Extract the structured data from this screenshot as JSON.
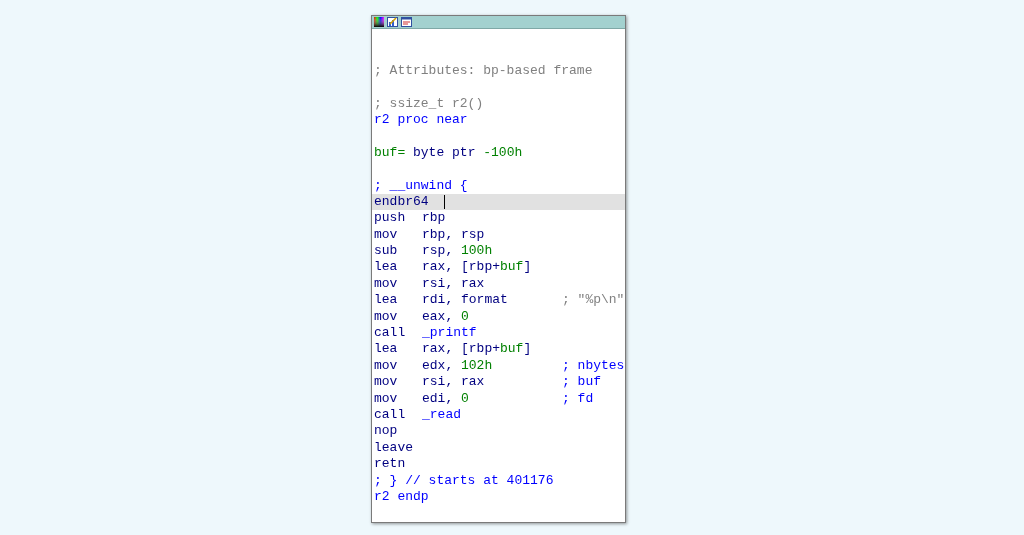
{
  "lines": [
    {
      "kind": "blank"
    },
    {
      "kind": "blank"
    },
    {
      "kind": "text",
      "selected": false,
      "parts": [
        {
          "text": "; Attributes: bp-based frame",
          "kind": "comment"
        }
      ]
    },
    {
      "kind": "blank"
    },
    {
      "kind": "text",
      "selected": false,
      "parts": [
        {
          "text": "; ssize_t r2()",
          "kind": "comment"
        }
      ]
    },
    {
      "kind": "text",
      "selected": false,
      "parts": [
        {
          "text": "r2 proc near",
          "kind": "name"
        }
      ]
    },
    {
      "kind": "blank"
    },
    {
      "kind": "text",
      "selected": false,
      "parts": [
        {
          "text": "buf=",
          "kind": "num"
        },
        {
          "text": " byte ptr ",
          "kind": "plain"
        },
        {
          "text": "-100h",
          "kind": "num"
        }
      ]
    },
    {
      "kind": "blank"
    },
    {
      "kind": "text",
      "selected": false,
      "parts": [
        {
          "text": "; __unwind {",
          "kind": "name"
        }
      ]
    },
    {
      "kind": "code",
      "selected": true,
      "mnemonic": "endbr64"
    },
    {
      "kind": "code",
      "selected": false,
      "mnemonic": "push",
      "operands": [
        {
          "text": "rbp",
          "kind": "plain"
        }
      ]
    },
    {
      "kind": "code",
      "selected": false,
      "mnemonic": "mov",
      "operands": [
        {
          "text": "rbp, rsp",
          "kind": "plain"
        }
      ]
    },
    {
      "kind": "code",
      "selected": false,
      "mnemonic": "sub",
      "operands": [
        {
          "text": "rsp, ",
          "kind": "plain"
        },
        {
          "text": "100h",
          "kind": "num"
        }
      ]
    },
    {
      "kind": "code",
      "selected": false,
      "mnemonic": "lea",
      "operands": [
        {
          "text": "rax, [rbp+",
          "kind": "plain"
        },
        {
          "text": "buf",
          "kind": "num"
        },
        {
          "text": "]",
          "kind": "plain"
        }
      ]
    },
    {
      "kind": "code",
      "selected": false,
      "mnemonic": "mov",
      "operands": [
        {
          "text": "rsi, rax",
          "kind": "plain"
        }
      ]
    },
    {
      "kind": "code",
      "selected": false,
      "mnemonic": "lea",
      "operands": [
        {
          "text": "rdi, format",
          "kind": "plain"
        }
      ],
      "comment": {
        "text": "; \"%p\\n\"",
        "kind": "comment"
      }
    },
    {
      "kind": "code",
      "selected": false,
      "mnemonic": "mov",
      "operands": [
        {
          "text": "eax, ",
          "kind": "plain"
        },
        {
          "text": "0",
          "kind": "num"
        }
      ]
    },
    {
      "kind": "code",
      "selected": false,
      "mnemonic": "call",
      "operands": [
        {
          "text": "_printf",
          "kind": "name"
        }
      ]
    },
    {
      "kind": "code",
      "selected": false,
      "mnemonic": "lea",
      "operands": [
        {
          "text": "rax, [rbp+",
          "kind": "plain"
        },
        {
          "text": "buf",
          "kind": "num"
        },
        {
          "text": "]",
          "kind": "plain"
        }
      ]
    },
    {
      "kind": "code",
      "selected": false,
      "mnemonic": "mov",
      "operands": [
        {
          "text": "edx, ",
          "kind": "plain"
        },
        {
          "text": "102h",
          "kind": "num"
        }
      ],
      "comment": {
        "text": "; nbytes",
        "kind": "name"
      }
    },
    {
      "kind": "code",
      "selected": false,
      "mnemonic": "mov",
      "operands": [
        {
          "text": "rsi, rax",
          "kind": "plain"
        }
      ],
      "comment": {
        "text": "; buf",
        "kind": "name"
      }
    },
    {
      "kind": "code",
      "selected": false,
      "mnemonic": "mov",
      "operands": [
        {
          "text": "edi, ",
          "kind": "plain"
        },
        {
          "text": "0",
          "kind": "num"
        }
      ],
      "comment": {
        "text": "; fd",
        "kind": "name"
      }
    },
    {
      "kind": "code",
      "selected": false,
      "mnemonic": "call",
      "operands": [
        {
          "text": "_read",
          "kind": "name"
        }
      ]
    },
    {
      "kind": "code",
      "selected": false,
      "mnemonic": "nop"
    },
    {
      "kind": "code",
      "selected": false,
      "mnemonic": "leave"
    },
    {
      "kind": "code",
      "selected": false,
      "mnemonic": "retn"
    },
    {
      "kind": "text",
      "selected": false,
      "parts": [
        {
          "text": "; } // starts at 401176",
          "kind": "name"
        }
      ]
    },
    {
      "kind": "text",
      "selected": false,
      "parts": [
        {
          "text": "r2 endp",
          "kind": "name"
        }
      ]
    }
  ]
}
